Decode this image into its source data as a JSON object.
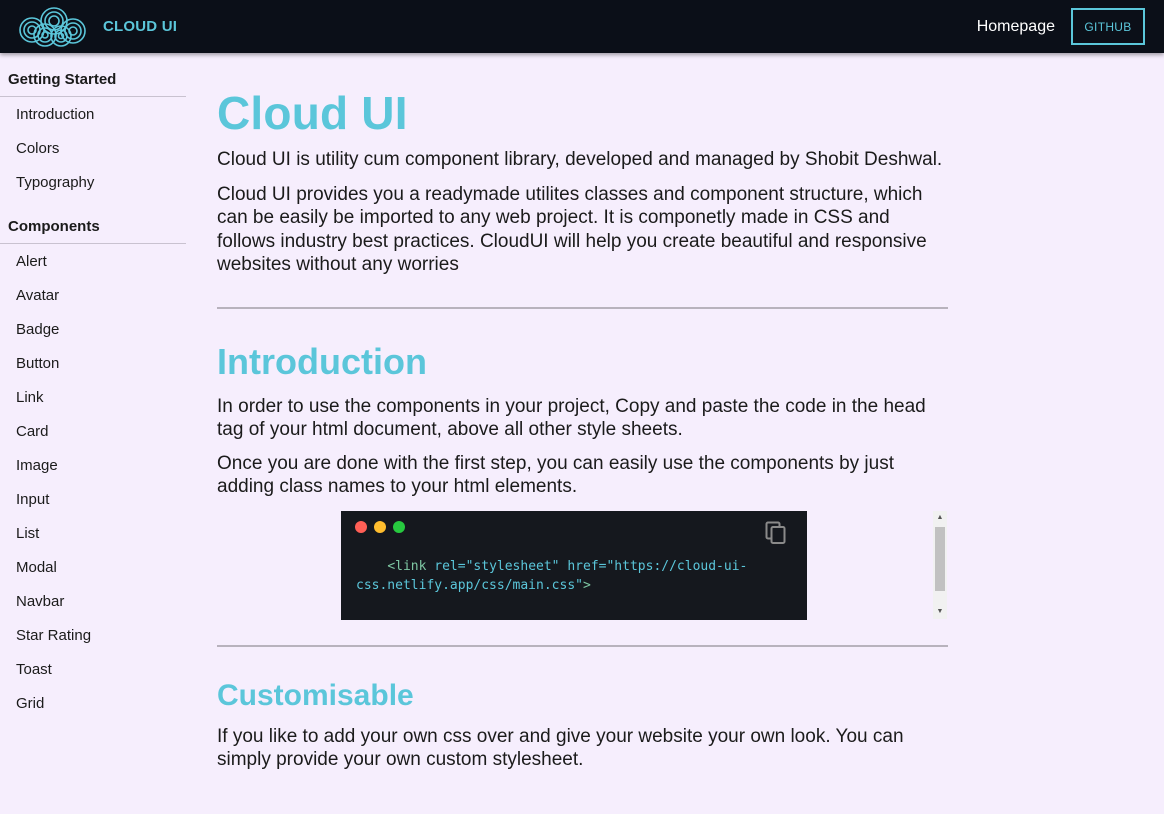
{
  "navbar": {
    "brand": "CLOUD UI",
    "homepage_link": "Homepage",
    "github_button": "GITHUB"
  },
  "sidebar": {
    "section1": {
      "heading": "Getting Started",
      "items": [
        "Introduction",
        "Colors",
        "Typography"
      ]
    },
    "section2": {
      "heading": "Components",
      "items": [
        "Alert",
        "Avatar",
        "Badge",
        "Button",
        "Link",
        "Card",
        "Image",
        "Input",
        "List",
        "Modal",
        "Navbar",
        "Star Rating",
        "Toast",
        "Grid"
      ]
    }
  },
  "main": {
    "title": "Cloud UI",
    "intro_p1": "Cloud UI is utility cum component library, developed and managed by Shobit Deshwal.",
    "intro_p2": "Cloud UI provides you a readymade utilites classes and component structure, which can be easily be imported to any web project. It is componetly made in CSS and follows industry best practices. CloudUI will help you create beautiful and responsive websites without any worries",
    "introduction_heading": "Introduction",
    "introduction_p1": "In order to use the components in your project, Copy and paste the code in the head tag of your html document, above all other style sheets.",
    "introduction_p2": "Once you are done with the first step, you can easily use the components by just adding class names to your html elements.",
    "code": {
      "open_tag": "<link",
      "attr1": " rel=",
      "val1": "\"stylesheet\"",
      "attr2": " href=",
      "val2": "\"https://cloud-ui-css.netlify.app/css/main.css\"",
      "close_tag": ">"
    },
    "customisable_heading": "Customisable",
    "customisable_p1": "If you like to add your own css over and give your website your own look. You can simply provide your own custom stylesheet."
  },
  "colors": {
    "accent": "#5bc6da",
    "navbar_bg": "#0b0f18",
    "page_bg": "#f6eefd",
    "code_bg": "#15181e",
    "dot_red": "#ff5f56",
    "dot_yellow": "#ffbd2e",
    "dot_green": "#27c93f"
  },
  "icons": {
    "logo": "cloud-logo-icon",
    "copy": "copy-icon"
  }
}
